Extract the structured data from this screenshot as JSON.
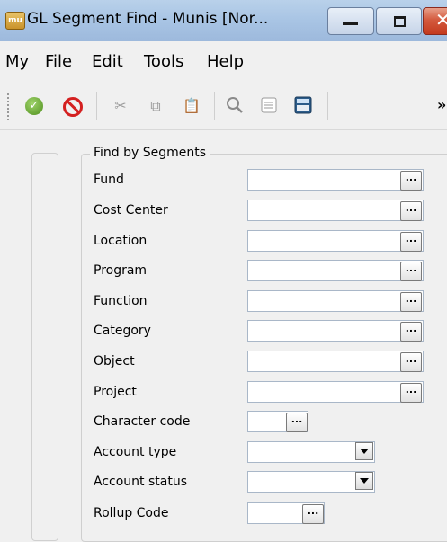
{
  "window": {
    "title": "GL Segment Find - Munis [Nor...",
    "app_icon_text": "mu"
  },
  "menu": {
    "items": [
      "My",
      "File",
      "Edit",
      "Tools",
      "Help"
    ]
  },
  "toolbar": {
    "icons": [
      "accept-icon",
      "cancel-icon",
      "cut-icon",
      "copy-icon",
      "paste-icon",
      "search-icon",
      "list-icon",
      "calculator-icon",
      "more-icon"
    ],
    "more_label": "»"
  },
  "form": {
    "group_title": "Find by Segments",
    "lookup_label": "...",
    "fields": [
      {
        "label": "Fund",
        "value": ""
      },
      {
        "label": "Cost Center",
        "value": ""
      },
      {
        "label": "Location",
        "value": ""
      },
      {
        "label": "Program",
        "value": ""
      },
      {
        "label": "Function",
        "value": ""
      },
      {
        "label": "Category",
        "value": ""
      },
      {
        "label": "Object",
        "value": ""
      },
      {
        "label": "Project",
        "value": ""
      },
      {
        "label": "Character code",
        "value": ""
      },
      {
        "label": "Account type",
        "value": ""
      },
      {
        "label": "Account status",
        "value": ""
      },
      {
        "label": "Rollup Code",
        "value": ""
      }
    ]
  }
}
